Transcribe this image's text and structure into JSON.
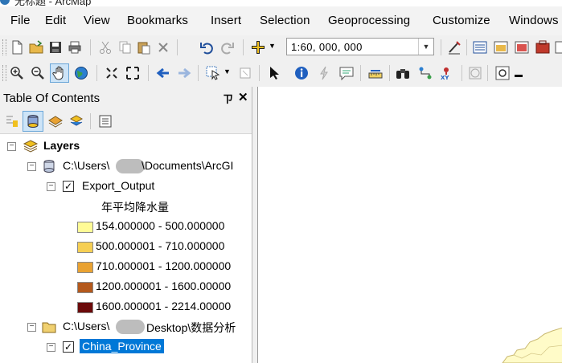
{
  "window": {
    "title": "无标题 - ArcMap"
  },
  "menu": [
    "File",
    "Edit",
    "View",
    "Bookmarks",
    "Insert",
    "Selection",
    "Geoprocessing",
    "Customize",
    "Windows"
  ],
  "toolbar": {
    "scale_value": "1:60, 000, 000"
  },
  "toc": {
    "title": "Table Of Contents",
    "pin": "ㄗ",
    "close": "✕",
    "layers_label": "Layers",
    "group1": {
      "path_prefix": "C:\\Users\\",
      "path_suffix": "\\Documents\\ArcGI"
    },
    "export_layer": {
      "name": "Export_Output",
      "field": "年平均降水量"
    },
    "legend": [
      {
        "label": "154.000000 - 500.000000",
        "color": "#fffb96"
      },
      {
        "label": "500.000001 - 710.000000",
        "color": "#f6cf54"
      },
      {
        "label": "710.000001 - 1200.000000",
        "color": "#e9a232"
      },
      {
        "label": "1200.000001 - 1600.00000",
        "color": "#b4591c"
      },
      {
        "label": "1600.000001 - 2214.00000",
        "color": "#6b0a0a"
      }
    ],
    "group2": {
      "path_prefix": "C:\\Users\\",
      "path_suffix": "Desktop\\数据分析"
    },
    "province_layer": {
      "name": "China_Province"
    }
  },
  "colors": {
    "selection": "#0078d7",
    "map_polygon": "#fffbc8"
  }
}
